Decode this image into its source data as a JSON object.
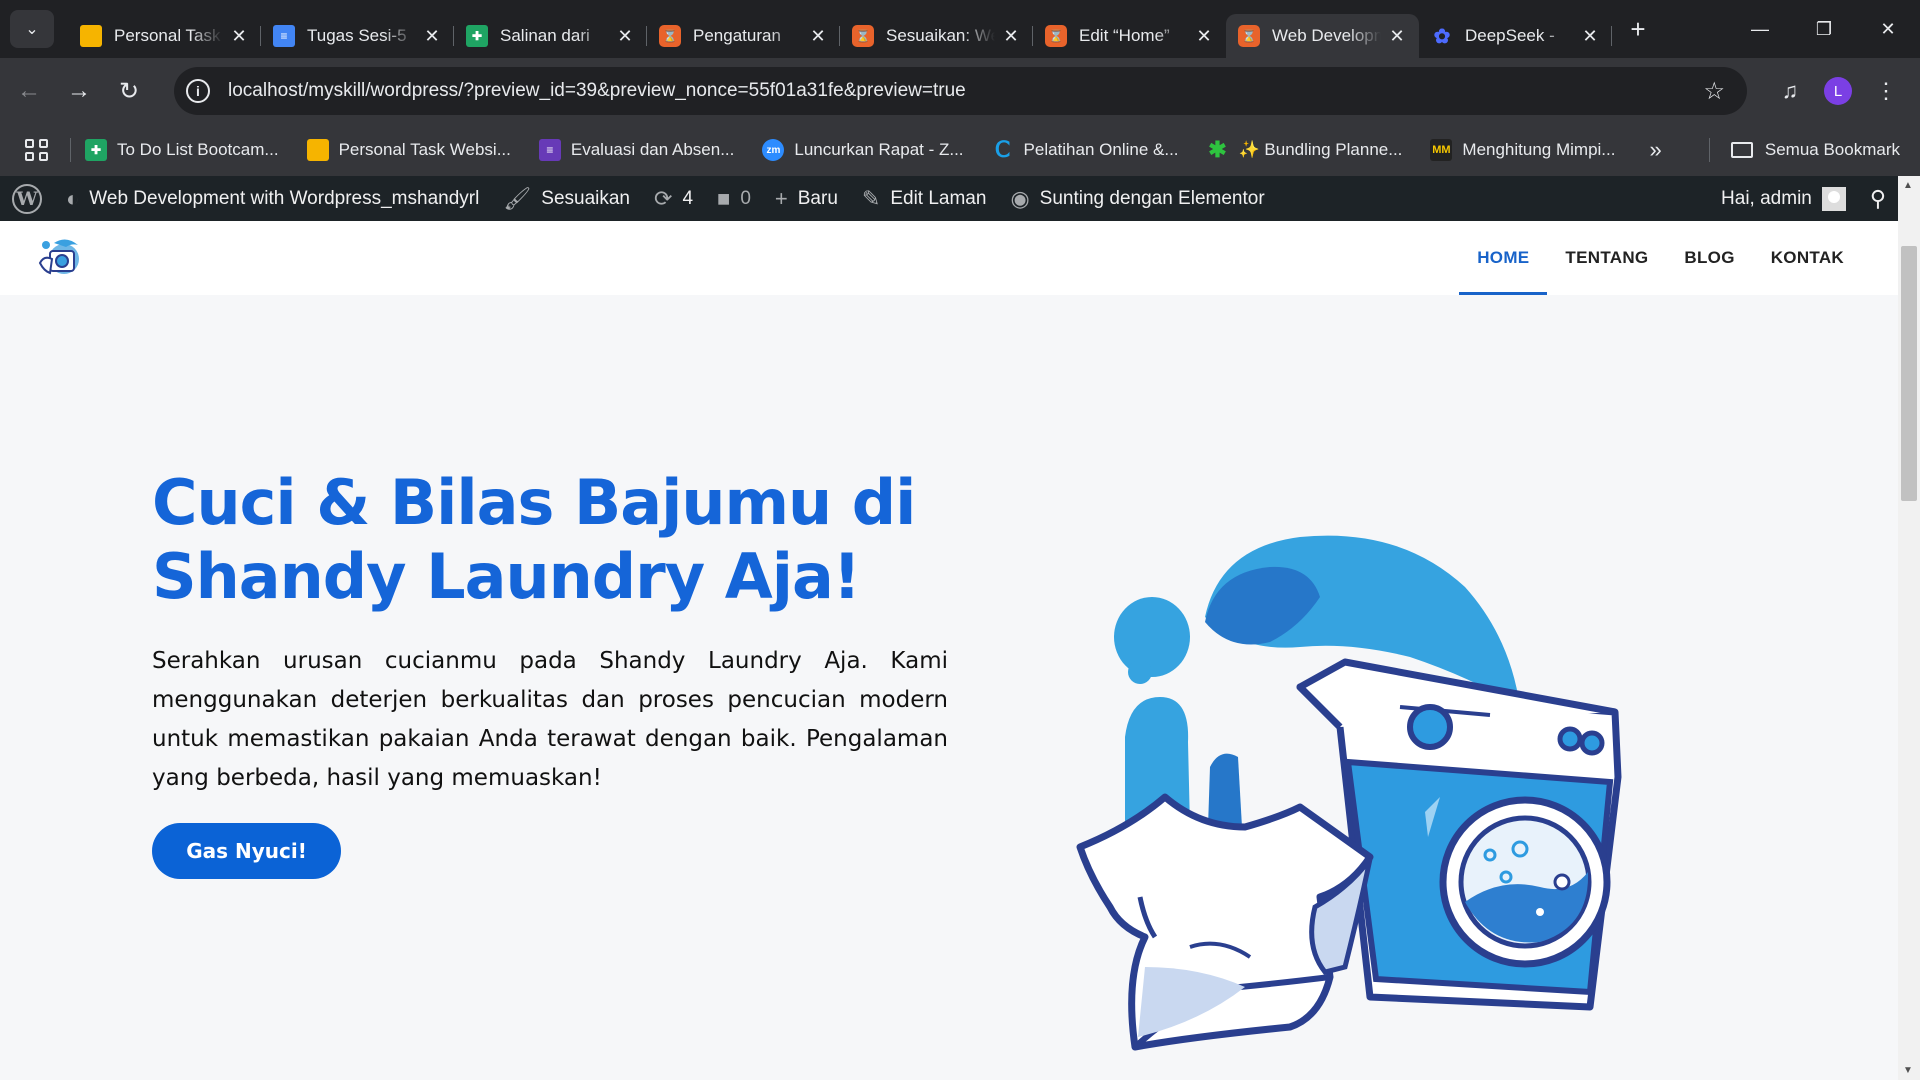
{
  "browser": {
    "tabs": [
      {
        "title": "Personal Task Website",
        "favicon": "slides-yellow",
        "color": "#f6b400"
      },
      {
        "title": "Tugas Sesi-5",
        "favicon": "docs-blue",
        "color": "#4285f4"
      },
      {
        "title": "Salinan dari",
        "favicon": "sheets-green",
        "color": "#1fa463"
      },
      {
        "title": "Pengaturan",
        "favicon": "xampp-orange",
        "color": "#e8632b"
      },
      {
        "title": "Sesuaikan: Web",
        "favicon": "xampp-orange",
        "color": "#e8632b"
      },
      {
        "title": "Edit “Home”",
        "favicon": "xampp-orange",
        "color": "#e8632b"
      },
      {
        "title": "Web Development",
        "favicon": "xampp-orange",
        "color": "#e8632b",
        "active": true
      },
      {
        "title": "DeepSeek - ",
        "favicon": "deepseek-whale",
        "color": "#4d6bfe"
      }
    ],
    "url": "localhost/myskill/wordpress/?preview_id=39&preview_nonce=55f01a31fe&preview=true",
    "profile_initial": "L",
    "bookmarks": [
      {
        "label": "To Do List Bootcam...",
        "favicon": "sheets-green"
      },
      {
        "label": "Personal Task Websi...",
        "favicon": "slides-yellow"
      },
      {
        "label": "Evaluasi dan Absen...",
        "favicon": "forms-purple"
      },
      {
        "label": "Luncurkan Rapat - Z...",
        "favicon": "zoom-blue"
      },
      {
        "label": "Pelatihan Online &...",
        "favicon": "c-logo"
      },
      {
        "label": "✨ Bundling Planne...",
        "favicon": "green-star"
      },
      {
        "label": "Menghitung Mimpi...",
        "favicon": "mm-logo"
      }
    ],
    "all_bookmarks_label": "Semua Bookmark"
  },
  "adminbar": {
    "site_name": "Web Development with Wordpress_mshandyrl",
    "customize": "Sesuaikan",
    "updates_count": "4",
    "comments_count": "0",
    "new": "Baru",
    "edit_page": "Edit Laman",
    "elementor": "Sunting dengan Elementor",
    "greeting": "Hai, admin"
  },
  "site": {
    "nav": [
      "HOME",
      "TENTANG",
      "BLOG",
      "KONTAK"
    ],
    "active_nav": "HOME",
    "hero_title": "Cuci & Bilas Bajumu di Shandy Laundry Aja!",
    "hero_text": "Serahkan urusan cucianmu pada Shandy Laundry Aja. Kami menggunakan deterjen berkualitas dan proses pencucian modern untuk memastikan pakaian Anda terawat dengan baik. Pengalaman yang berbeda, hasil yang memuaskan!",
    "hero_button": "Gas Nyuci!"
  },
  "colors": {
    "brand_blue": "#1565d8",
    "button_blue": "#0b63d6",
    "adminbar_bg": "#1d2327",
    "hero_bg": "#f6f7f9"
  }
}
